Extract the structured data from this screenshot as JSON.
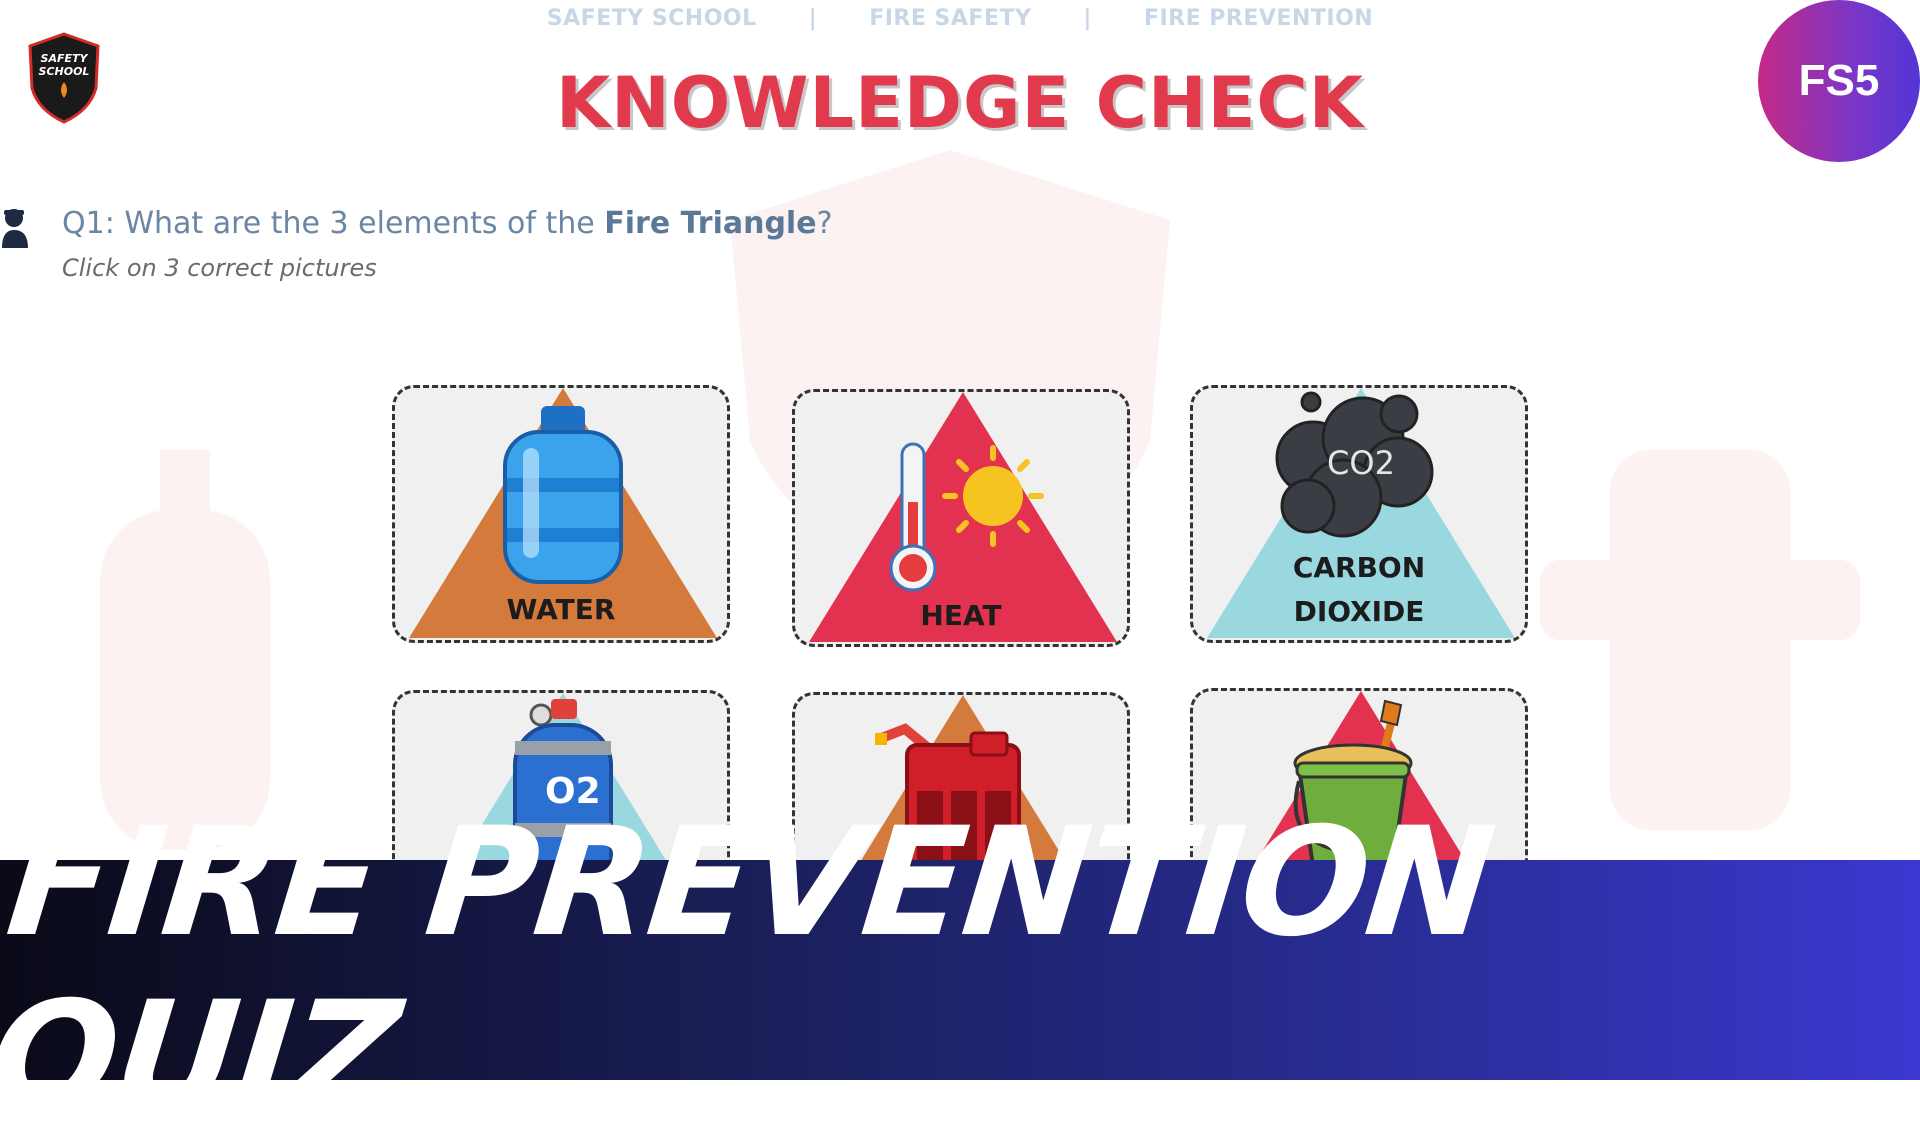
{
  "nav": {
    "items": [
      "SAFETY SCHOOL",
      "FIRE SAFETY",
      "FIRE PREVENTION"
    ],
    "separator": "|"
  },
  "logo": {
    "text_line1": "SAFETY",
    "text_line2": "SCHOOL"
  },
  "title": "KNOWLEDGE CHECK",
  "badge": "FS5",
  "question": {
    "prefix": "Q1: What are the 3 elements of the ",
    "emphasis": "Fire Triangle",
    "suffix": "?",
    "instruction": "Click on 3 correct pictures"
  },
  "cards": [
    {
      "label": "WATER",
      "icon": "water-bottle-icon",
      "triangle_color": "#d47a3c"
    },
    {
      "label": "HEAT",
      "icon": "thermometer-sun-icon",
      "triangle_color": "#e2324f"
    },
    {
      "label_line1": "CARBON",
      "label_line2": "DIOXIDE",
      "icon": "co2-cloud-icon",
      "cloud_text": "CO2",
      "triangle_color": "#9ad8e0"
    },
    {
      "label": "",
      "icon": "oxygen-tank-icon",
      "tank_text": "O2",
      "triangle_color": "#9ad8e0"
    },
    {
      "label": "",
      "icon": "fuel-can-icon",
      "triangle_color": "#d47a3c"
    },
    {
      "label": "",
      "icon": "sand-bucket-icon",
      "triangle_color": "#e2324f"
    }
  ],
  "banner": {
    "text": "FIRE PREVENTION QUIZ"
  },
  "colors": {
    "title": "#e23a4d",
    "nav": "#c9d6e6",
    "question": "#6a86a4",
    "badge_start": "#c42a86",
    "badge_end": "#5335d6",
    "banner_start": "#0a0a18",
    "banner_end": "#3a38d0"
  }
}
